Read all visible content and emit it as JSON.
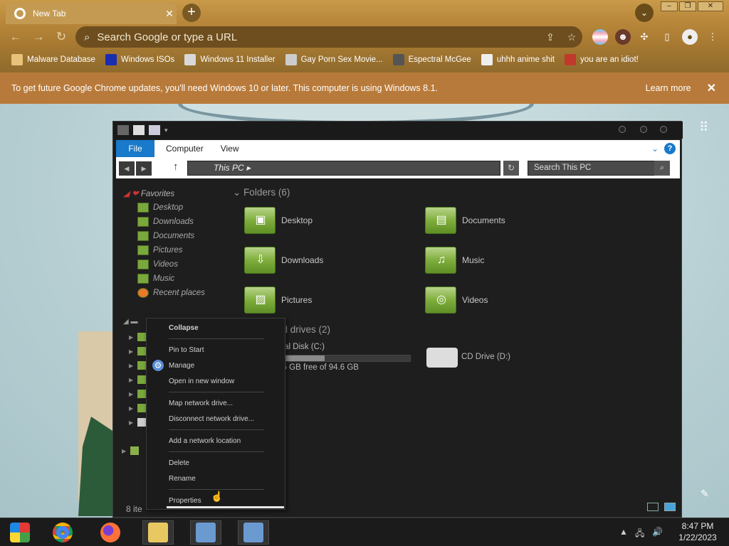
{
  "browser": {
    "tab_title": "New Tab",
    "tab_close": "✕",
    "new_tab": "+",
    "omnibox_placeholder": "Search Google or type a URL",
    "bookmarks": [
      {
        "label": "Malware Database",
        "color": "#e9c27a"
      },
      {
        "label": "Windows ISOs",
        "color": "#1a2db0"
      },
      {
        "label": "Windows 11 Installer",
        "color": "#d8d8d8"
      },
      {
        "label": "Gay Porn Sex Movie...",
        "color": "#cccccc"
      },
      {
        "label": "Espectral McGee",
        "color": "#555555"
      },
      {
        "label": "uhhh anime shit",
        "color": "#eeeeee"
      },
      {
        "label": "you are an idiot!",
        "color": "#c0392b"
      }
    ],
    "update_message": "To get future Google Chrome updates, you'll need Windows 10 or later. This computer is using Windows 8.1.",
    "learn_more": "Learn more",
    "update_close": "✕"
  },
  "explorer": {
    "ribbon": {
      "file": "File",
      "tabs": [
        "Computer",
        "View"
      ],
      "help": "?"
    },
    "address": "This PC",
    "search_placeholder": "Search This PC",
    "nav": {
      "favorites": "Favorites",
      "items": [
        "Desktop",
        "Downloads",
        "Documents",
        "Pictures",
        "Videos",
        "Music",
        "Recent places"
      ]
    },
    "folders_header": "Folders (6)",
    "folders": [
      "Desktop",
      "Documents",
      "Downloads",
      "Music",
      "Pictures",
      "Videos"
    ],
    "drives_header": "nd drives (2)",
    "local_disk": "ocal Disk (C:)",
    "local_disk_free": "5.5 GB free of 94.6 GB",
    "cd_drive": "CD Drive (D:)",
    "status": "8 ite"
  },
  "context_menu": {
    "items": [
      "Collapse",
      "Pin to Start",
      "Manage",
      "Open in new window",
      "Map network drive...",
      "Disconnect network drive...",
      "Add a network location",
      "Delete",
      "Rename",
      "Properties"
    ]
  },
  "taskbar": {
    "time": "8:47 PM",
    "date": "1/22/2023"
  }
}
